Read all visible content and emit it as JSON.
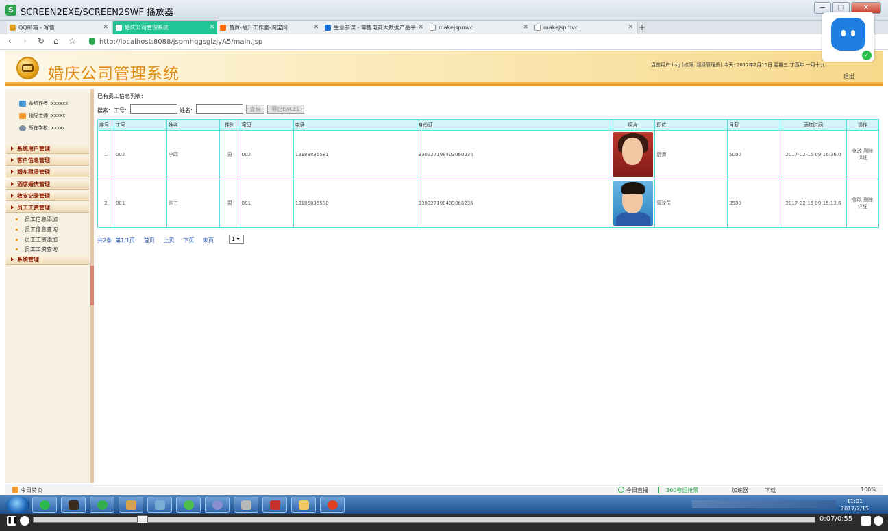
{
  "window": {
    "title": "SCREEN2EXE/SCREEN2SWF 播放器",
    "min": "─",
    "max": "□",
    "close": "✕"
  },
  "tabs": [
    {
      "label": "QQ邮箱 - 写信",
      "close": "✕",
      "color": "#e0a020"
    },
    {
      "label": "婚庆公司管理系统",
      "close": "✕",
      "color": "#ffffff"
    },
    {
      "label": "首页-易升工作室-淘宝网",
      "close": "✕",
      "color": "#ff6a00"
    },
    {
      "label": "生意参谋 - 零售电商大数据产品平",
      "close": "✕",
      "color": "#1e74d6"
    },
    {
      "label": "makejspmvc",
      "close": "✕",
      "color": "#bbbbbb"
    },
    {
      "label": "makejspmvc",
      "close": "✕",
      "color": "#bbbbbb"
    }
  ],
  "newtab": "+",
  "address": {
    "url": "http://localhost:8088/jspmhqgsglzjyA5/main.jsp",
    "back": "‹",
    "forward": "›",
    "reload": "↻",
    "home": "⌂",
    "star": "☆"
  },
  "header": {
    "title": "婚庆公司管理系统",
    "userinfo": "当前用户:hsg [权限: 超级管理员] 今天: 2017年2月15日 星期三 丁酉年 一月十九",
    "logout": "退出"
  },
  "sidebar": {
    "info": [
      {
        "label": "系统作者: xxxxxx",
        "icon": "people-icon",
        "color": "#4a9ad8"
      },
      {
        "label": "指导老师: xxxxx",
        "icon": "teacher-icon",
        "color": "#f39a30"
      },
      {
        "label": "所在学校: xxxxx",
        "icon": "school-icon",
        "color": "#7a8da0"
      }
    ],
    "menus": [
      "系统用户管理",
      "客户信息管理",
      "婚车租赁管理",
      "酒席婚庆管理",
      "收支记录管理",
      "员工工资管理"
    ],
    "submenus": [
      "员工信息添加",
      "员工信息查询",
      "员工工资添加",
      "员工工资查询"
    ],
    "lastmenu": "系统管理"
  },
  "main": {
    "caption": "已有员工信息列表:",
    "search_label": "搜索:",
    "id_label": "工号:",
    "name_label": "姓名:",
    "query_btn": "查询",
    "export_btn": "导出EXCEL",
    "columns": [
      "序号",
      "工号",
      "姓名",
      "性别",
      "密码",
      "电话",
      "身份证",
      "照片",
      "职位",
      "月薪",
      "添加时间",
      "操作"
    ],
    "rows": [
      {
        "no": "1",
        "id": "002",
        "name": "李四",
        "sex": "男",
        "pwd": "002",
        "phone": "13186835581",
        "idcard": "330327198403060236",
        "position": "厨师",
        "salary": "5000",
        "time": "2017-02-15 09:16:36.0",
        "edit": "修改",
        "del": "删除",
        "detail": "详细"
      },
      {
        "no": "2",
        "id": "001",
        "name": "张三",
        "sex": "男",
        "pwd": "001",
        "phone": "13186835580",
        "idcard": "330327198403060235",
        "position": "驾驶员",
        "salary": "3500",
        "time": "2017-02-15 09:15:13.0",
        "edit": "修改",
        "del": "删除",
        "detail": "详细"
      }
    ],
    "pager": {
      "total": "共2条",
      "page": "第1/1页",
      "first": "首页",
      "prev": "上页",
      "next": "下页",
      "last": "末页",
      "select": "1 ▾"
    }
  },
  "status": {
    "left": "今日特卖",
    "live": "今日直播",
    "promo": "360春运抢票",
    "accel": "加速器",
    "download": "下载",
    "zoom": "100%"
  },
  "taskbar": {
    "time": "11:01",
    "date": "2017/2/15"
  },
  "player": {
    "time": "0:07/0:55"
  }
}
